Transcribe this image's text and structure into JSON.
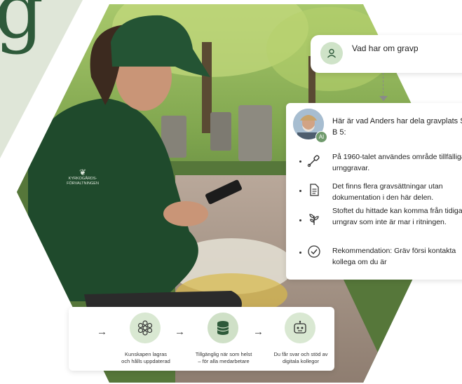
{
  "brand": {
    "big_letter": "g",
    "jacket_logo_line1": "KYRKOGÅRDS-",
    "jacket_logo_line2": "FÖRVALTNINGEN"
  },
  "question": {
    "icon": "user-icon",
    "text": "Vad har om gravp"
  },
  "answer": {
    "avatar": "bearded-man-avatar",
    "badge": "AI",
    "intro": "Här är vad Anders har dela gravplats SK B 5:",
    "items": [
      {
        "icon": "shovel-icon",
        "text": "På 1960-talet användes område tillfälliga urnggravar."
      },
      {
        "icon": "document-icon",
        "text": "Det finns flera gravsättningar utan dokumentation i den här delen."
      },
      {
        "icon": "plant-icon",
        "text": "Stoftet du hittade kan komma från tidigare urngrav som inte är mar i ritningen."
      },
      {
        "icon": "check-circle-icon",
        "text": "Rekommendation: Gräv försi kontakta kollega om du är"
      }
    ]
  },
  "process": {
    "steps": [
      {
        "icon": "network-flower-icon",
        "line1": "Kunskapen lagras",
        "line2": "och hålls uppdaterad"
      },
      {
        "icon": "database-icon",
        "line1": "Tillgänglig när som helst",
        "line2": "– för alla medarbetare"
      },
      {
        "icon": "robot-icon",
        "line1": "Du får svar och stöd av",
        "line2": "digitala kollegor"
      }
    ]
  },
  "colors": {
    "accent_green": "#2e5a3a",
    "icon_bg": "#d9e8d2",
    "panel_bg": "#dfe6d8"
  }
}
